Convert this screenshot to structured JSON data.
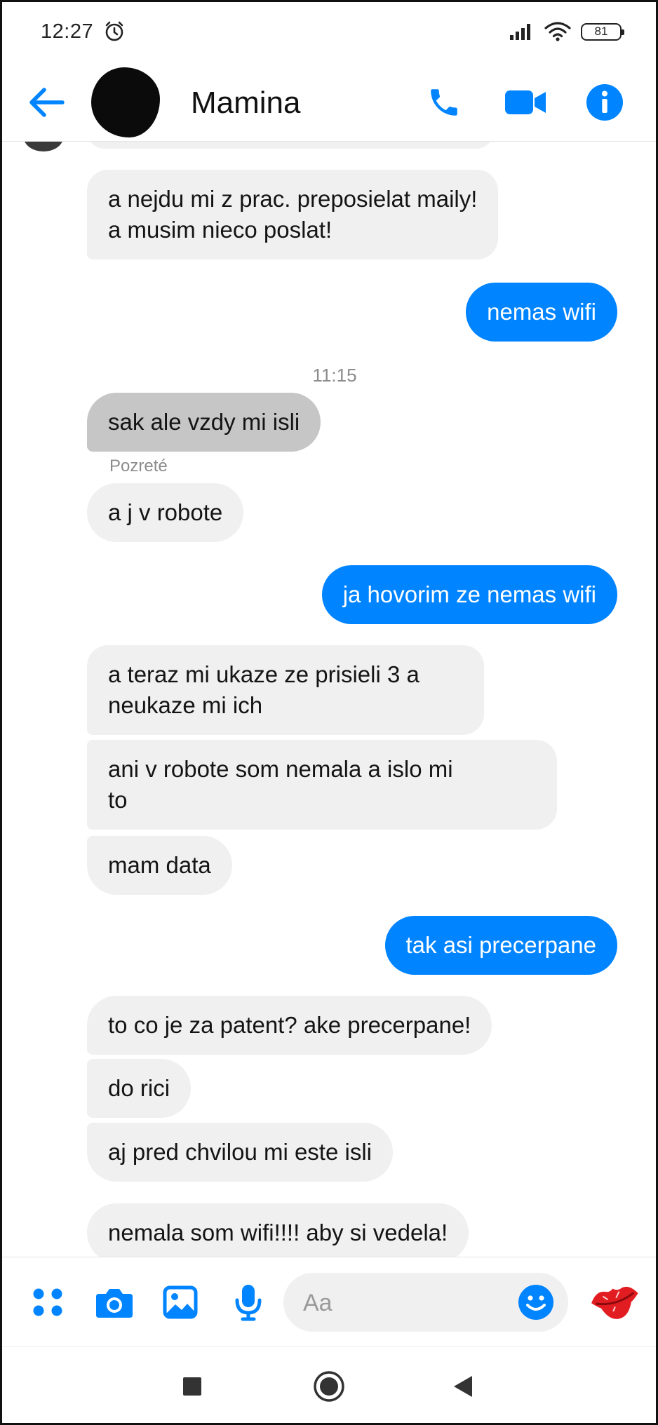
{
  "status": {
    "time": "12:27",
    "battery": "81",
    "icons": [
      "alarm-icon",
      "signal-icon",
      "wifi-icon",
      "battery-icon"
    ]
  },
  "header": {
    "contact_name": "Mamina",
    "icons": [
      "back-arrow-icon",
      "phone-icon",
      "video-camera-icon",
      "info-icon"
    ],
    "accent_color": "#0084ff"
  },
  "thread": {
    "timestamp": "11:15",
    "seen_label": "Pozreté",
    "messages": [
      {
        "side": "in",
        "lines": [
          "a nejdu mi z prac. preposielat maily!",
          "a musim nieco poslat!"
        ]
      },
      {
        "side": "out",
        "lines": [
          "nemas wifi"
        ]
      },
      {
        "side": "in",
        "lines": [
          "sak ale vzdy mi isli"
        ],
        "selected": true
      },
      {
        "side": "in",
        "lines": [
          "a j v robote"
        ]
      },
      {
        "side": "out",
        "lines": [
          "ja hovorim ze nemas wifi"
        ]
      },
      {
        "side": "in",
        "lines": [
          "a teraz mi ukaze ze prisieli 3 a",
          "neukaze mi ich"
        ]
      },
      {
        "side": "in",
        "lines": [
          "ani v robote som nemala a islo mi",
          "to"
        ]
      },
      {
        "side": "in",
        "lines": [
          "mam data"
        ]
      },
      {
        "side": "out",
        "lines": [
          "tak asi precerpane"
        ]
      },
      {
        "side": "in",
        "lines": [
          "to co je za patent? ake precerpane!"
        ]
      },
      {
        "side": "in",
        "lines": [
          "do rici"
        ]
      },
      {
        "side": "in",
        "lines": [
          "aj pred chvilou mi este isli"
        ]
      },
      {
        "side": "in",
        "lines": [
          "nemala som wifi!!!! aby si vedela!"
        ]
      }
    ],
    "incoming_bg": "#f0f0f0",
    "outgoing_bg": "#0084ff"
  },
  "composer": {
    "placeholder": "Aa",
    "icons": [
      "apps-grid-icon",
      "camera-icon",
      "gallery-icon",
      "microphone-icon",
      "emoji-icon",
      "kiss-lips-icon"
    ]
  },
  "navbar": {
    "icons": [
      "recents-square-icon",
      "home-circle-icon",
      "back-triangle-icon"
    ]
  }
}
